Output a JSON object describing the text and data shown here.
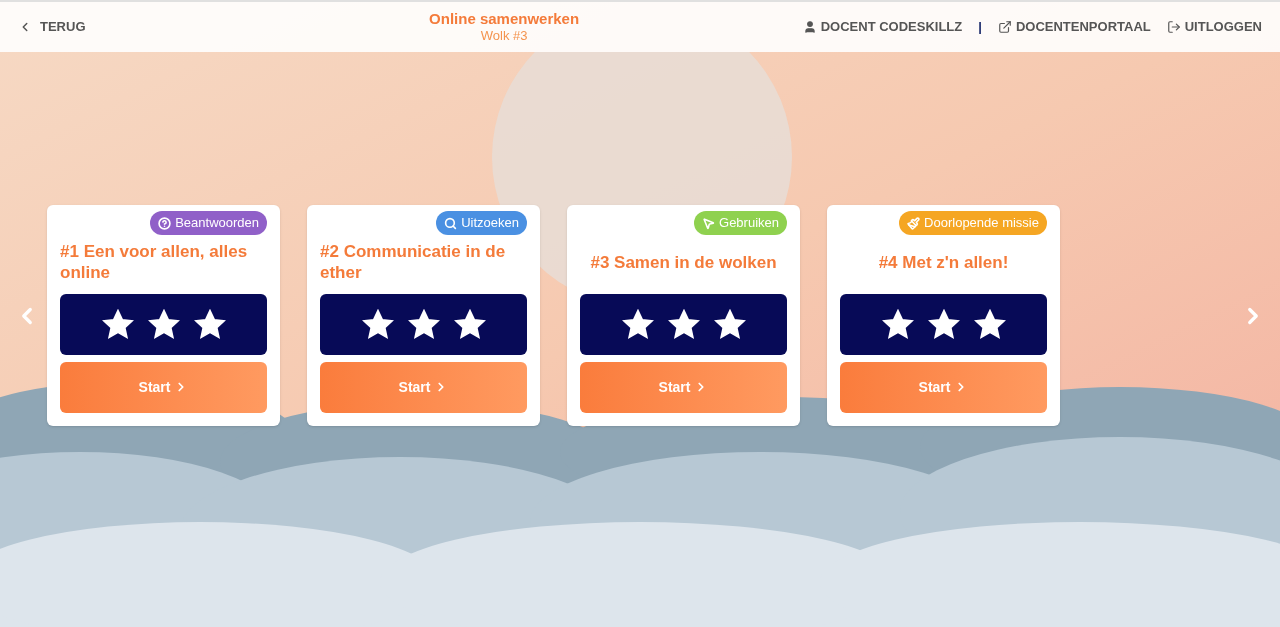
{
  "header": {
    "back": "TERUG",
    "title": "Online samenwerken",
    "subtitle": "Wolk #3",
    "user": "DOCENT CODESKILLZ",
    "separator": "|",
    "portal": "DOCENTENPORTAAL",
    "logout": "UITLOGGEN"
  },
  "cards": [
    {
      "badge": {
        "kind": "question",
        "label": "Beantwoorden",
        "color": "#9060c8"
      },
      "title": "#1 Een voor allen, alles online",
      "stars": 3,
      "button": "Start"
    },
    {
      "badge": {
        "kind": "search",
        "label": "Uitzoeken",
        "color": "#4a90e2"
      },
      "title": "#2 Communicatie in de ether",
      "stars": 3,
      "button": "Start"
    },
    {
      "badge": {
        "kind": "pointer",
        "label": "Gebruiken",
        "color": "#8fd14f"
      },
      "title": "#3 Samen in de wolken",
      "stars": 3,
      "button": "Start"
    },
    {
      "badge": {
        "kind": "brush",
        "label": "Doorlopende missie",
        "color": "#f5a623"
      },
      "title": "#4 Met z'n allen!",
      "stars": 3,
      "button": "Start"
    }
  ]
}
